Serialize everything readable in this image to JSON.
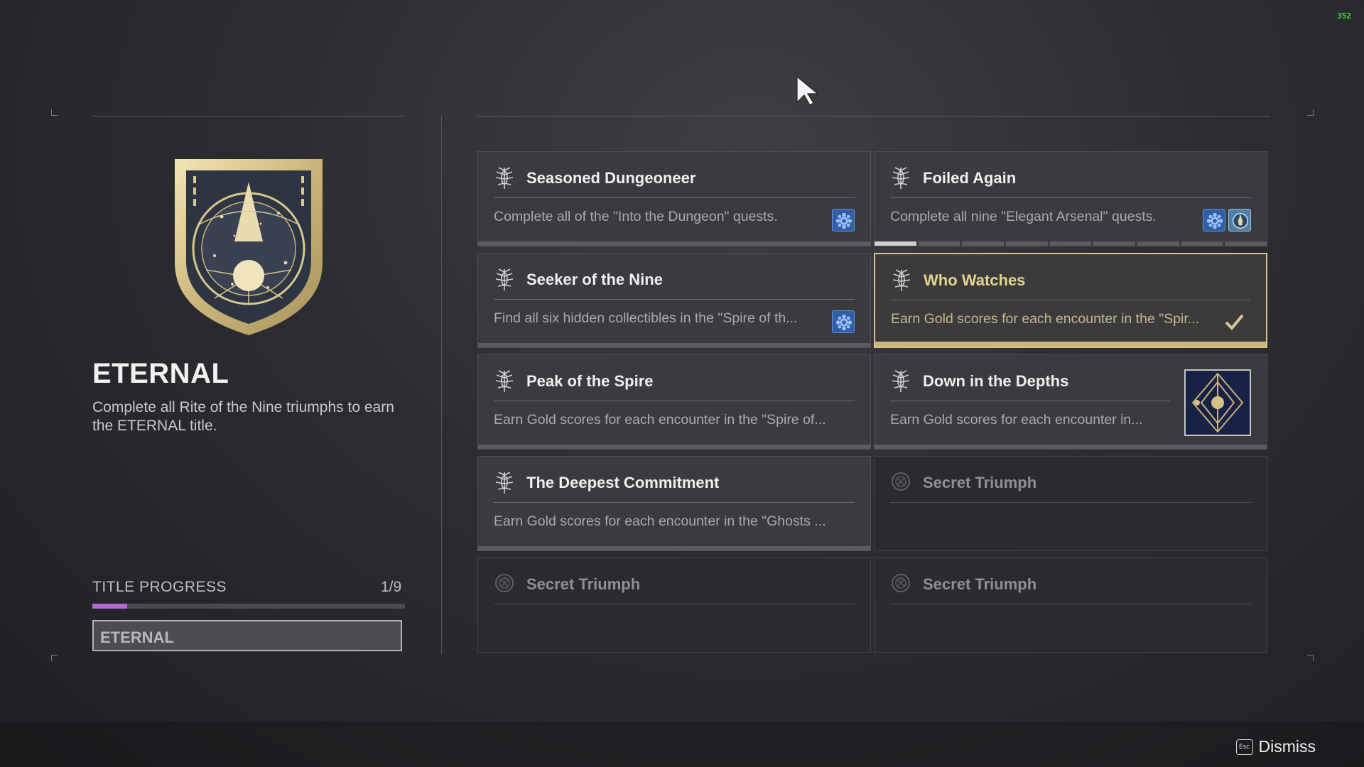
{
  "fps_counter": "352",
  "title": {
    "name": "ETERNAL",
    "description": "Complete all Rite of the Nine triumphs to earn the ETERNAL title.",
    "progress_label": "TITLE PROGRESS",
    "progress_count": "1/9",
    "progress_fraction": 0.111,
    "equipped_title": "ETERNAL"
  },
  "triumphs": [
    {
      "name": "Seasoned Dungeoneer",
      "description": "Complete all of the \"Into the Dungeon\" quests.",
      "state": "incomplete",
      "rewards": [
        "ghost-shell-icon"
      ]
    },
    {
      "name": "Foiled Again",
      "description": "Complete all nine \"Elegant Arsenal\" quests.",
      "state": "in-progress",
      "progress_segments": 9,
      "progress_completed": 1,
      "rewards": [
        "ghost-shell-icon",
        "emblem-icon"
      ]
    },
    {
      "name": "Seeker of the Nine",
      "description": "Find all six hidden collectibles in  the \"Spire of th...",
      "state": "incomplete",
      "rewards": [
        "ghost-shell-icon"
      ]
    },
    {
      "name": "Who Watches",
      "description": "Earn Gold scores for each encounter in the \"Spir...",
      "state": "completed",
      "rewards": [
        "checkmark-icon"
      ]
    },
    {
      "name": "Peak of the Spire",
      "description": "Earn Gold scores for each encounter in the \"Spire of...",
      "state": "incomplete",
      "rewards": []
    },
    {
      "name": "Down in the Depths",
      "description": "Earn Gold scores for each encounter in...",
      "state": "incomplete",
      "rewards": [
        "emblem-art"
      ]
    },
    {
      "name": "The Deepest Commitment",
      "description": "Earn Gold scores for each encounter in the \"Ghosts ...",
      "state": "incomplete",
      "rewards": []
    },
    {
      "name": "Secret Triumph",
      "description": "",
      "state": "secret",
      "rewards": []
    },
    {
      "name": "Secret Triumph",
      "description": "",
      "state": "secret",
      "rewards": []
    },
    {
      "name": "Secret Triumph",
      "description": "",
      "state": "secret",
      "rewards": []
    }
  ],
  "footer": {
    "key_label": "Esc",
    "dismiss_label": "Dismiss"
  },
  "colors": {
    "accent_gold": "#d4c38a",
    "progress_purple": "#b76ad6",
    "reward_blue": "#2f5fa6"
  }
}
